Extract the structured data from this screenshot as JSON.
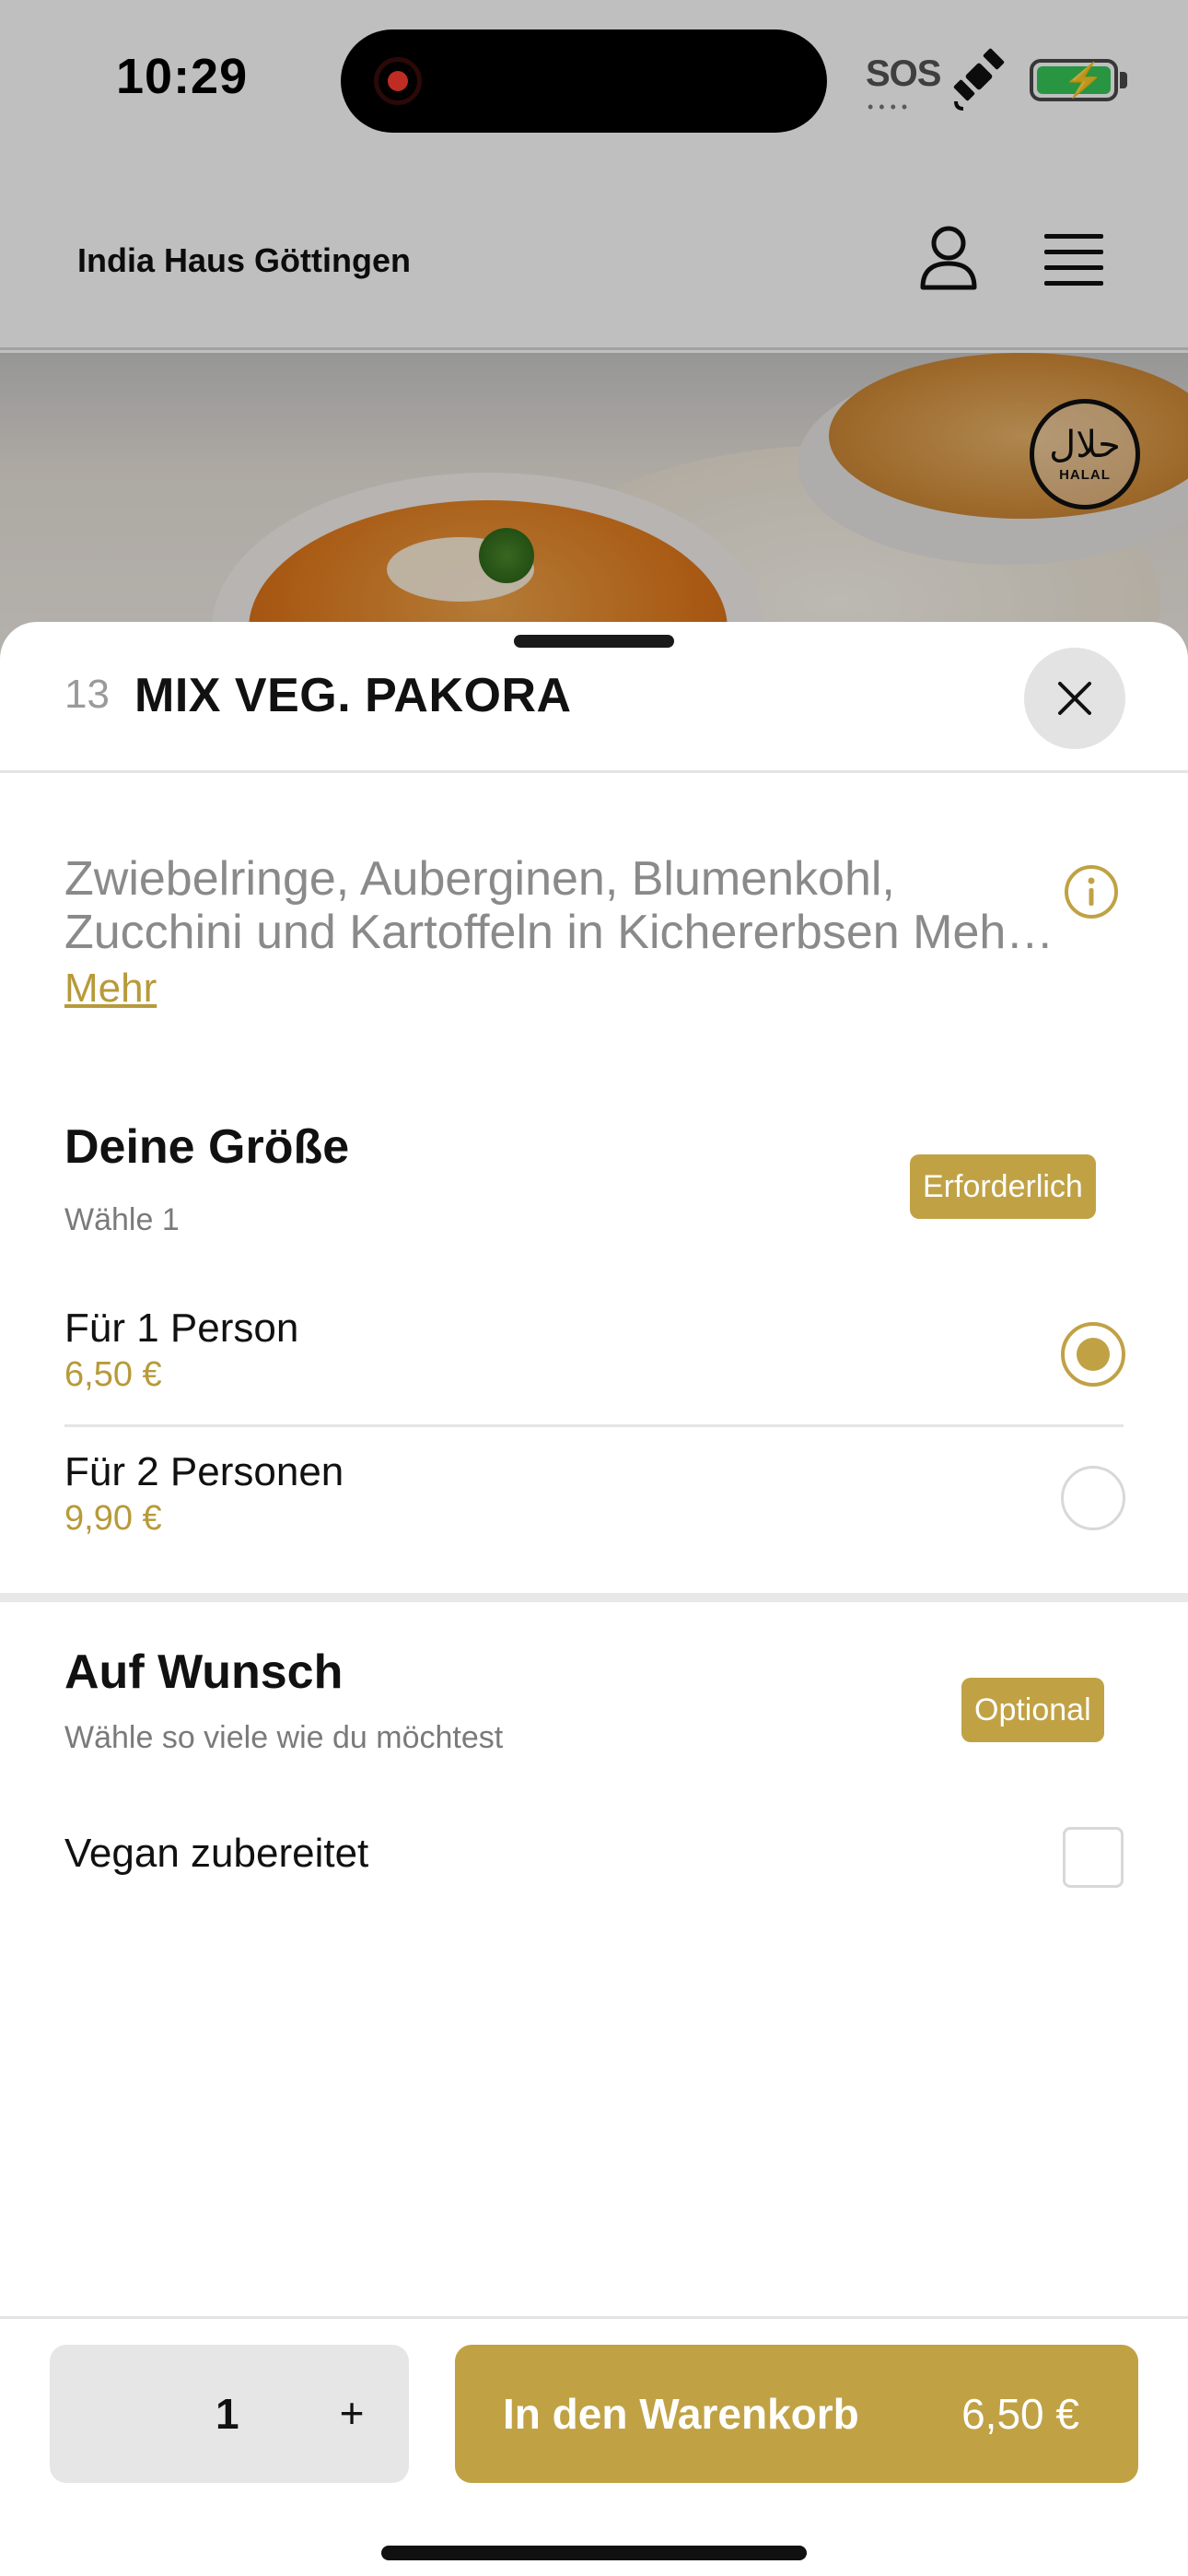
{
  "status_bar": {
    "time": "10:29",
    "sos_label": "SOS",
    "icons": [
      "recording-indicator-icon",
      "satellite-icon",
      "battery-charging-icon"
    ]
  },
  "header": {
    "brand": "India Haus Göttingen",
    "icons": [
      "user-icon",
      "menu-icon"
    ]
  },
  "hero": {
    "badge_text": "HALAL",
    "badge_arabic": "حلال"
  },
  "item": {
    "number": "13",
    "title": "MIX VEG. PAKORA",
    "description": "Zwiebelringe, Auberginen, Blumenkohl, Zucchini und Kartoffeln in Kichererbsen Mehl gebacken",
    "more_link": "Mehr"
  },
  "size_section": {
    "title": "Deine Größe",
    "subtitle": "Wähle 1",
    "badge": "Erforderlich",
    "options": [
      {
        "label": "Für 1 Person",
        "price": "6,50 €",
        "selected": true
      },
      {
        "label": "Für 2 Personen",
        "price": "9,90 €",
        "selected": false
      }
    ]
  },
  "extras_section": {
    "title": "Auf Wunsch",
    "subtitle": "Wähle so viele wie du möchtest",
    "badge": "Optional",
    "options": [
      {
        "label": "Vegan zubereitet",
        "checked": false
      }
    ]
  },
  "footer": {
    "quantity": "1",
    "plus_label": "+",
    "cart_label": "In den Warenkorb",
    "cart_price": "6,50 €"
  },
  "colors": {
    "accent": "#c0a245",
    "price_text": "#b79a3a",
    "muted_text": "#8a8a8a"
  }
}
